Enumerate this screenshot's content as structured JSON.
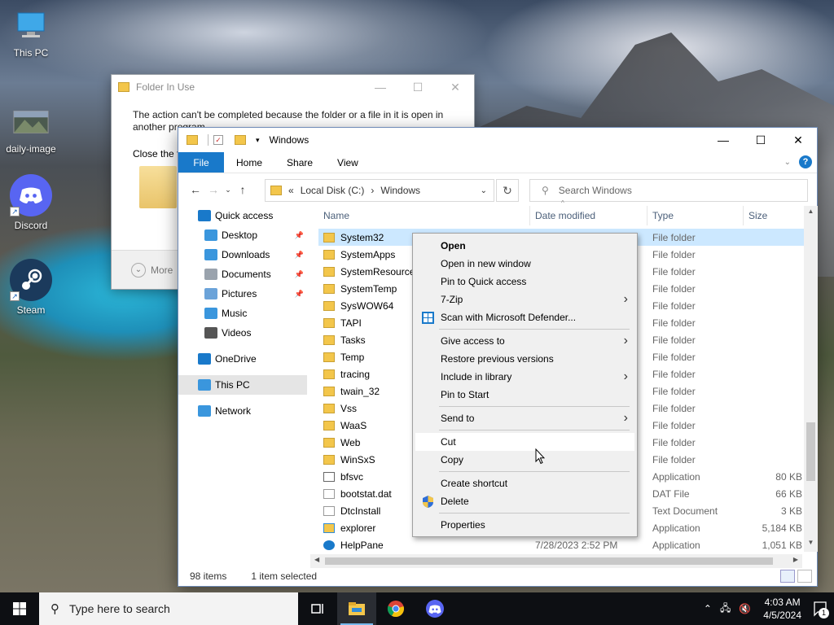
{
  "desktop": {
    "icons": [
      {
        "label": "This PC"
      },
      {
        "label": "daily-image"
      },
      {
        "label": "Discord"
      },
      {
        "label": "Steam"
      }
    ]
  },
  "dialog": {
    "title": "Folder In Use",
    "message": "The action can't be completed because the folder or a file in it is open in another program",
    "message2": "Close the f",
    "more_label": "More"
  },
  "explorer": {
    "title": "Windows",
    "ribbon": {
      "file": "File",
      "tabs": [
        "Home",
        "Share",
        "View"
      ]
    },
    "address": {
      "prefix": "«",
      "parts": [
        "Local Disk (C:)",
        "Windows"
      ],
      "separator": "›"
    },
    "search_placeholder": "Search Windows",
    "nav": [
      {
        "label": "Quick access",
        "icon": "star-icon",
        "color": "#1979ca"
      },
      {
        "label": "Desktop",
        "icon": "desktop-icon",
        "color": "#3a96dd",
        "pinned": true
      },
      {
        "label": "Downloads",
        "icon": "download-icon",
        "color": "#3a96dd",
        "pinned": true
      },
      {
        "label": "Documents",
        "icon": "document-icon",
        "color": "#9aa3ad",
        "pinned": true
      },
      {
        "label": "Pictures",
        "icon": "pictures-icon",
        "color": "#6ba3d9",
        "pinned": true
      },
      {
        "label": "Music",
        "icon": "music-icon",
        "color": "#3a96dd"
      },
      {
        "label": "Videos",
        "icon": "video-icon",
        "color": "#555"
      },
      {
        "label": "OneDrive",
        "icon": "cloud-icon",
        "color": "#1979ca"
      },
      {
        "label": "This PC",
        "icon": "computer-icon",
        "color": "#3a96dd"
      },
      {
        "label": "Network",
        "icon": "network-icon",
        "color": "#3a96dd"
      }
    ],
    "columns": [
      "Name",
      "Date modified",
      "Type",
      "Size"
    ],
    "files": [
      {
        "name": "System32",
        "date": "",
        "type": "File folder",
        "size": "",
        "kind": "folder"
      },
      {
        "name": "SystemApps",
        "date": "",
        "type": "File folder",
        "size": "",
        "kind": "folder"
      },
      {
        "name": "SystemResources",
        "date": "",
        "type": "File folder",
        "size": "",
        "kind": "folder"
      },
      {
        "name": "SystemTemp",
        "date": "",
        "type": "File folder",
        "size": "",
        "kind": "folder"
      },
      {
        "name": "SysWOW64",
        "date": "",
        "type": "File folder",
        "size": "",
        "kind": "folder"
      },
      {
        "name": "TAPI",
        "date": "",
        "type": "File folder",
        "size": "",
        "kind": "folder"
      },
      {
        "name": "Tasks",
        "date": "",
        "type": "File folder",
        "size": "",
        "kind": "folder"
      },
      {
        "name": "Temp",
        "date": "",
        "type": "File folder",
        "size": "",
        "kind": "folder"
      },
      {
        "name": "tracing",
        "date": "",
        "type": "File folder",
        "size": "",
        "kind": "folder"
      },
      {
        "name": "twain_32",
        "date": "",
        "type": "File folder",
        "size": "",
        "kind": "folder"
      },
      {
        "name": "Vss",
        "date": "",
        "type": "File folder",
        "size": "",
        "kind": "folder"
      },
      {
        "name": "WaaS",
        "date": "",
        "type": "File folder",
        "size": "",
        "kind": "folder"
      },
      {
        "name": "Web",
        "date": "",
        "type": "File folder",
        "size": "",
        "kind": "folder"
      },
      {
        "name": "WinSxS",
        "date": "",
        "type": "File folder",
        "size": "",
        "kind": "folder"
      },
      {
        "name": "bfsvc",
        "date": "",
        "type": "Application",
        "size": "80 KB",
        "kind": "app"
      },
      {
        "name": "bootstat.dat",
        "date": "",
        "type": "DAT File",
        "size": "66 KB",
        "kind": "file"
      },
      {
        "name": "DtcInstall",
        "date": "",
        "type": "Text Document",
        "size": "3 KB",
        "kind": "text"
      },
      {
        "name": "explorer",
        "date": "",
        "type": "Application",
        "size": "5,184 KB",
        "kind": "explorer"
      },
      {
        "name": "HelpPane",
        "date": "7/28/2023 2:52 PM",
        "type": "Application",
        "size": "1,051 KB",
        "kind": "help"
      }
    ],
    "status": {
      "count": "98 items",
      "selected": "1 item selected"
    }
  },
  "context_menu": {
    "items": [
      {
        "label": "Open",
        "bold": true
      },
      {
        "label": "Open in new window"
      },
      {
        "label": "Pin to Quick access"
      },
      {
        "label": "7-Zip",
        "submenu": true
      },
      {
        "label": "Scan with Microsoft Defender...",
        "icon": "defender-icon"
      },
      {
        "sep": true
      },
      {
        "label": "Give access to",
        "submenu": true
      },
      {
        "label": "Restore previous versions"
      },
      {
        "label": "Include in library",
        "submenu": true
      },
      {
        "label": "Pin to Start"
      },
      {
        "sep": true
      },
      {
        "label": "Send to",
        "submenu": true
      },
      {
        "sep": true
      },
      {
        "label": "Cut",
        "hover": true
      },
      {
        "label": "Copy"
      },
      {
        "sep": true
      },
      {
        "label": "Create shortcut"
      },
      {
        "label": "Delete",
        "icon": "shield-icon"
      },
      {
        "sep": true
      },
      {
        "label": "Properties"
      }
    ]
  },
  "taskbar": {
    "search_placeholder": "Type here to search",
    "time": "4:03 AM",
    "date": "4/5/2024",
    "notification_count": "1"
  }
}
